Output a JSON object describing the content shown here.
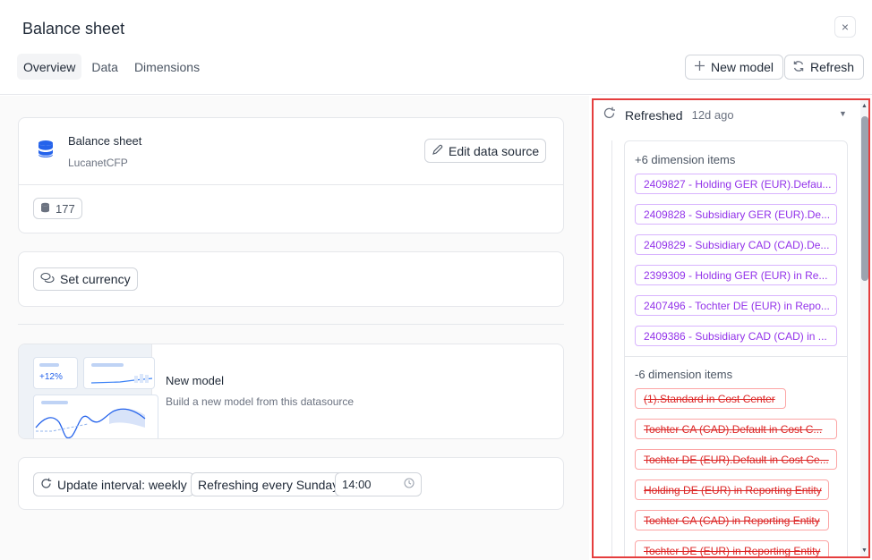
{
  "header": {
    "title": "Balance sheet",
    "close_glyph": "×",
    "tabs": [
      {
        "label": "Overview",
        "active": true
      },
      {
        "label": "Data",
        "active": false
      },
      {
        "label": "Dimensions",
        "active": false
      }
    ],
    "new_model_label": "New model",
    "refresh_label": "Refresh"
  },
  "source_card": {
    "name": "Balance sheet",
    "provider": "LucanetCFP",
    "edit_label": "Edit data source",
    "count": "177"
  },
  "currency_card": {
    "label": "Set currency"
  },
  "model_card": {
    "title": "New model",
    "description": "Build a new model from this datasource",
    "preview_badge": "+12%"
  },
  "schedule_card": {
    "interval_label": "Update interval: weekly",
    "refresh_day_label": "Refreshing every Sunday",
    "time_value": "14:00"
  },
  "history": {
    "status": "Refreshed",
    "ago": "12d ago",
    "added_label": "+6 dimension items",
    "added": [
      "2409827 - Holding GER (EUR).Defau...",
      "2409828 - Subsidiary GER (EUR).De...",
      "2409829 - Subsidiary CAD (CAD).De...",
      "2399309 - Holding GER (EUR) in Re...",
      "2407496 - Tochter DE (EUR) in Repo...",
      "2409386 - Subsidiary CAD (CAD) in ..."
    ],
    "removed_label": "-6 dimension items",
    "removed": [
      "(1).Standard in Cost Center",
      "Tochter CA (CAD).Default in Cost C...",
      "Tochter DE (EUR).Default in Cost Ce...",
      "Holding DE (EUR) in Reporting Entity",
      "Tochter CA (CAD) in Reporting Entity",
      "Tochter DE (EUR) in Reporting Entity"
    ]
  },
  "colors": {
    "accent_blue": "#2563eb",
    "added_purple": "#9333ea",
    "removed_red": "#dc2626",
    "highlight_red": "#e53e3e"
  }
}
